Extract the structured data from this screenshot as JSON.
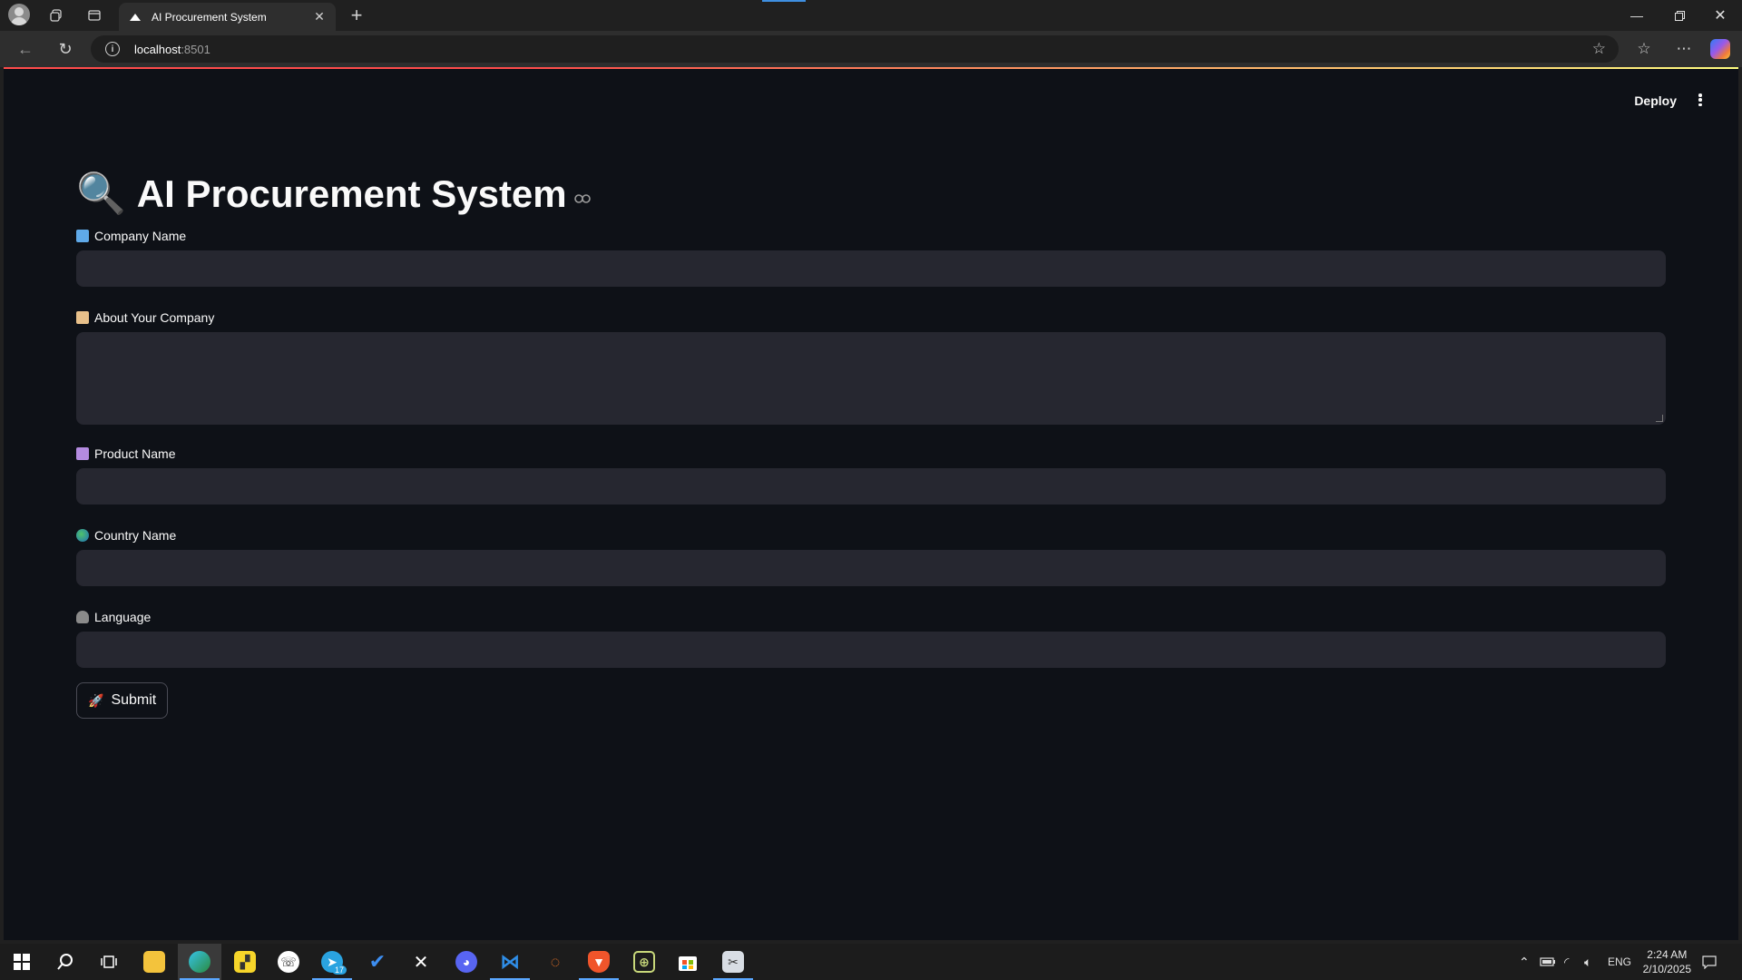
{
  "browser": {
    "tab_title": "AI Procurement System",
    "url_host": "localhost",
    "url_port": ":8501"
  },
  "app": {
    "deploy_label": "Deploy",
    "title_emoji": "🔍",
    "title": "AI Procurement System",
    "fields": [
      {
        "emoji": "🏢",
        "label": "Company Name",
        "value": "",
        "type": "input"
      },
      {
        "emoji": "📜",
        "label": "About Your Company",
        "value": "",
        "type": "textarea"
      },
      {
        "emoji": "🏬",
        "label": "Product Name",
        "value": "",
        "type": "input"
      },
      {
        "emoji": "🌍",
        "label": "Country Name",
        "value": "",
        "type": "input"
      },
      {
        "emoji": "🗣",
        "label": "Language",
        "value": "",
        "type": "input"
      }
    ],
    "submit_emoji": "🚀",
    "submit_label": "Submit"
  },
  "taskbar": {
    "telegram_badge": "17",
    "language": "ENG",
    "time": "2:24 AM",
    "date": "2/10/2025"
  },
  "colors": {
    "app_bg": "#0e1117",
    "input_bg": "#262730",
    "accent_red": "#ff4b4b",
    "accent_yellow": "#fffd80"
  }
}
